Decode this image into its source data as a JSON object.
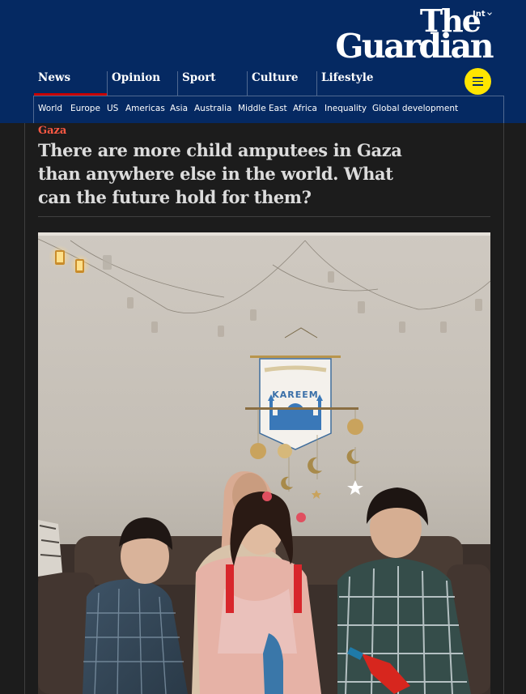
{
  "header": {
    "edition": "Int",
    "logo_line1": "The",
    "logo_line2": "Guardian"
  },
  "pillars": {
    "news": "News",
    "opinion": "Opinion",
    "sport": "Sport",
    "culture": "Culture",
    "lifestyle": "Lifestyle"
  },
  "subnav": [
    "World",
    "Europe",
    "US",
    "Americas",
    "Asia",
    "Australia",
    "Middle East",
    "Africa",
    "Inequality",
    "Global development"
  ],
  "article": {
    "kicker": "Gaza",
    "headline_line1": "There are more child amputees in Gaza",
    "headline_line2": "than anywhere else in the world. What",
    "headline_line3": "can the future hold for them?"
  },
  "photo": {
    "banner_text": "KAREEM"
  },
  "colors": {
    "brand_blue": "#052962",
    "news_red": "#c70000",
    "kicker_red": "#ff5943",
    "menu_yellow": "#ffe500",
    "background": "#1c1c1c"
  },
  "icons": {
    "menu": "menu-icon",
    "edition_dropdown": "chevron-down-icon"
  }
}
